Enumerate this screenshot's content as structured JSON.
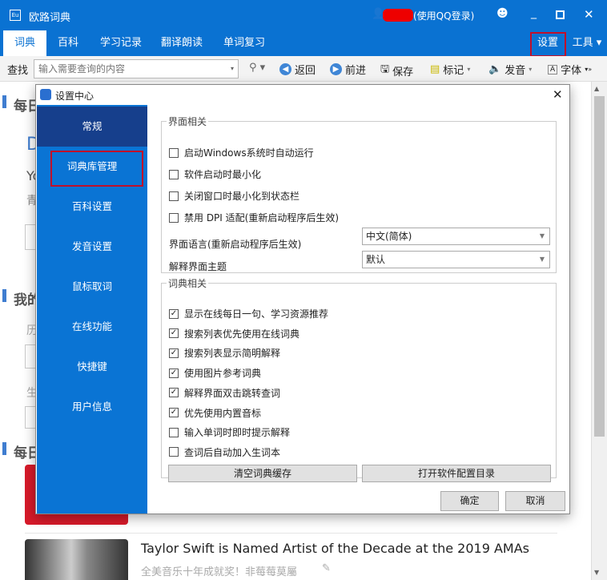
{
  "app": {
    "title": "欧路词典",
    "login": "(使用QQ登录)",
    "icon_text": "Eu"
  },
  "tabs": [
    "词典",
    "百科",
    "学习记录",
    "翻译朗读",
    "单词复习"
  ],
  "right_tabs": {
    "settings": "设置",
    "tools": "工具"
  },
  "toolbar": {
    "find_label": "查找",
    "search_placeholder": "输入需要查询的内容",
    "back": "返回",
    "forward": "前进",
    "save": "保存",
    "mark": "标记",
    "speak": "发音",
    "font": "字体"
  },
  "background": {
    "daily1": "每日",
    "word": "D",
    "line1": "Yo",
    "line2": "青",
    "mine": "我的",
    "history": "历",
    "vocab": "生",
    "daily2": "每日",
    "article_title": "Taylor Swift is Named Artist of the Decade at the 2019 AMAs",
    "article_sub": "全美音乐十年成就奖！非莓莓莫屬"
  },
  "dialog": {
    "title": "设置中心",
    "sidebar": [
      "常规",
      "词典库管理",
      "百科设置",
      "发音设置",
      "鼠标取词",
      "在线功能",
      "快捷键",
      "用户信息"
    ],
    "group1": {
      "title": "界面相关",
      "options": [
        {
          "label": "启动Windows系统时自动运行",
          "checked": false
        },
        {
          "label": "软件启动时最小化",
          "checked": false
        },
        {
          "label": "关闭窗口时最小化到状态栏",
          "checked": false
        },
        {
          "label": "禁用 DPI 适配(重新启动程序后生效)",
          "checked": false
        }
      ],
      "language_label": "界面语言(重新启动程序后生效)",
      "language_value": "中文(简体)",
      "theme_label": "解释界面主题",
      "theme_value": "默认"
    },
    "group2": {
      "title": "词典相关",
      "options": [
        {
          "label": "显示在线每日一句、学习资源推荐",
          "checked": true
        },
        {
          "label": "搜索列表优先使用在线词典",
          "checked": true
        },
        {
          "label": "搜索列表显示简明解释",
          "checked": true
        },
        {
          "label": "使用图片参考词典",
          "checked": true
        },
        {
          "label": "解释界面双击跳转查词",
          "checked": true
        },
        {
          "label": "优先使用内置音标",
          "checked": true
        },
        {
          "label": "输入单词时即时提示解释",
          "checked": false
        },
        {
          "label": "查词后自动加入生词本",
          "checked": false
        }
      ],
      "clear_cache": "清空词典缓存",
      "open_config": "打开软件配置目录"
    },
    "ok": "确定",
    "cancel": "取消"
  }
}
